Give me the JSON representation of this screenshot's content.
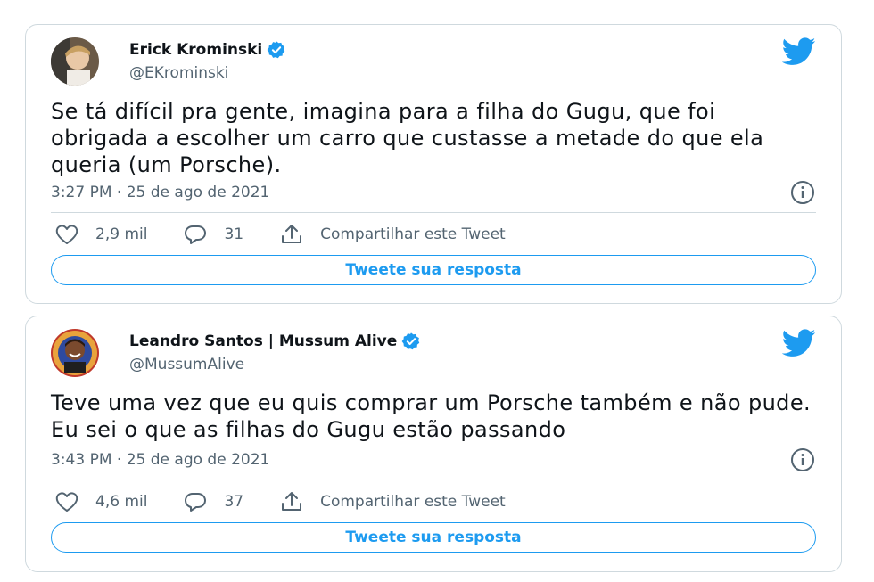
{
  "tweets": [
    {
      "display_name": "Erick Krominski",
      "handle": "@EKrominski",
      "text": "Se tá difícil pra gente, imagina para a filha do Gugu, que foi obrigada a escolher um carro que custasse a metade do que ela queria (um Porsche).",
      "timestamp": "3:27 PM · 25 de ago de 2021",
      "likes": "2,9 mil",
      "replies": "31",
      "share_label": "Compartilhar este Tweet",
      "reply_button_label": "Tweete sua resposta",
      "verified": true
    },
    {
      "display_name": "Leandro Santos | Mussum Alive",
      "handle": "@MussumAlive",
      "text": "Teve uma vez que eu quis comprar um Porsche também e não pude. Eu sei o que as filhas do Gugu estão passando",
      "timestamp": "3:43 PM · 25 de ago de 2021",
      "likes": "4,6 mil",
      "replies": "37",
      "share_label": "Compartilhar este Tweet",
      "reply_button_label": "Tweete sua resposta",
      "verified": true
    }
  ],
  "icons": {
    "brand": "twitter-bird-icon",
    "verified": "verified-badge-icon",
    "info": "info-icon",
    "like": "heart-icon",
    "reply": "speech-bubble-icon",
    "share": "share-icon"
  },
  "colors": {
    "accent": "#1d9bf0",
    "text": "#0f1419",
    "secondary_text": "#536471",
    "border": "#cfd9de"
  }
}
